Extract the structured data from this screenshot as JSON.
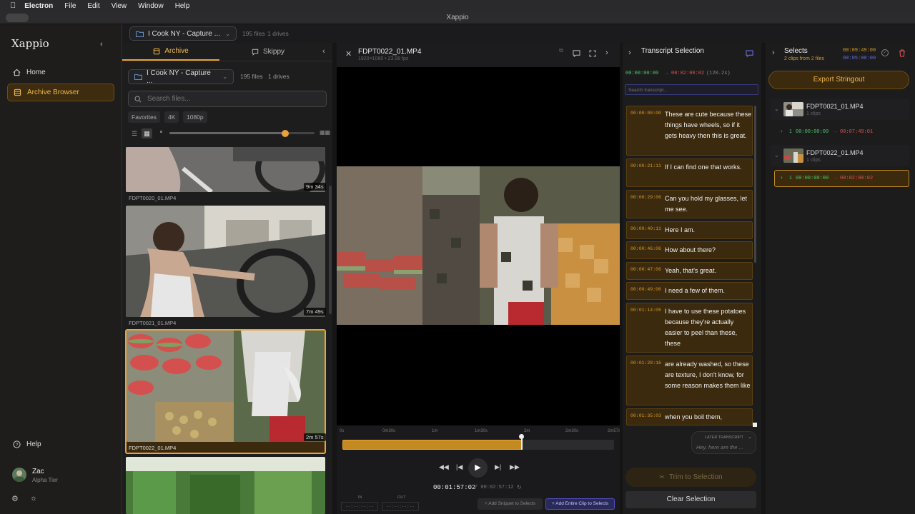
{
  "menubar": {
    "apple": "",
    "app": "Electron",
    "items": [
      "File",
      "Edit",
      "View",
      "Window",
      "Help"
    ]
  },
  "window": {
    "title": "Xappio"
  },
  "sidebar": {
    "logo": "Xappio",
    "nav": [
      {
        "label": "Home"
      },
      {
        "label": "Archive Browser"
      }
    ],
    "help": "Help",
    "user": {
      "name": "Zac",
      "tier": "Alpha Tier"
    }
  },
  "topbar": {
    "project": "I Cook NY - Capture ...",
    "files": "195 files",
    "drives": "1 drives"
  },
  "browser": {
    "tabs": [
      {
        "label": "Archive"
      },
      {
        "label": "Skippy"
      }
    ],
    "project": "I Cook NY - Capture ...",
    "files": "195 files",
    "drives": "1 drives",
    "search_placeholder": "Search files...",
    "filters": [
      "Favorites",
      "4K",
      "1080p"
    ],
    "clips": [
      {
        "name": "FDPT0020_01.MP4",
        "duration": "9m 34s"
      },
      {
        "name": "FDPT0021_01.MP4",
        "duration": "7m 49s"
      },
      {
        "name": "FDPT0022_01.MP4",
        "duration": "2m 57s"
      }
    ]
  },
  "player": {
    "filename": "FDPT0022_01.MP4",
    "meta": "1920×1080 • 23.98 fps",
    "ruler": [
      "0s",
      "0m30s",
      "1m",
      "1m30s",
      "2m",
      "2m30s",
      "2m57s"
    ],
    "timecode": "00:01:57:02",
    "duration": "/ 00:02:57:12",
    "in_label": "IN",
    "out_label": "OUT",
    "in_value": "--:--:--:--",
    "out_value": "--:--:--:--",
    "add_snippet": "+ Add Snippet to Selects",
    "add_clip": "+ Add Entire Clip to Selects",
    "progress": 0.66
  },
  "transcript": {
    "title": "Transcript Selection",
    "range_start": "00:00:00:00",
    "arrow": "→",
    "range_end": "00:02:00:02",
    "range_len": "(120.2s)",
    "search_placeholder": "Search transcript...",
    "segments": [
      {
        "ts": "00:00:00:00",
        "text": "These are cute because these things have wheels, so if it gets heavy then this is great."
      },
      {
        "ts": "00:00:21:11",
        "text": "If I can find one that works."
      },
      {
        "ts": "00:00:29:06",
        "text": "Can you hold my glasses, let me see."
      },
      {
        "ts": "00:00:40:11",
        "text": "Here I am."
      },
      {
        "ts": "00:00:46:06",
        "text": "How about there?"
      },
      {
        "ts": "00:00:47:06",
        "text": "Yeah, that's great."
      },
      {
        "ts": "00:00:49:06",
        "text": "I need a few of them."
      },
      {
        "ts": "00:01:14:05",
        "text": "I have to use these potatoes because they're actually easier to peel than these, these"
      },
      {
        "ts": "00:01:28:16",
        "text": "are already washed, so these are texture, I don't know, for some reason makes them like"
      },
      {
        "ts": "00:01:35:03",
        "text": "when you boil them,"
      }
    ],
    "later_label": "LATER TRANSCRIPT",
    "later_preview": "Hey, here are the ...",
    "trim_button": "Trim to Selection",
    "clear_button": "Clear Selection"
  },
  "selects": {
    "title": "Selects",
    "subtitle": "2 clips from 2 files",
    "total_time": "00:09:49:00",
    "sel_time": "00:05:00:00",
    "export_button": "Export Stringout",
    "groups": [
      {
        "name": "FDPT0021_01.MP4",
        "count": "1 clips",
        "item": {
          "idx": "1",
          "in": "00:00:00:00",
          "arrow": "→",
          "out": "00:07:49:01"
        }
      },
      {
        "name": "FDPT0022_01.MP4",
        "count": "1 clips",
        "item": {
          "idx": "1",
          "in": "00:00:00:00",
          "arrow": "→",
          "out": "00:02:00:02"
        }
      }
    ]
  },
  "colors": {
    "accent": "#e8a33a",
    "highlight_bg": "#3b2a0e",
    "green": "#3fbf5f",
    "red": "#e05050"
  }
}
